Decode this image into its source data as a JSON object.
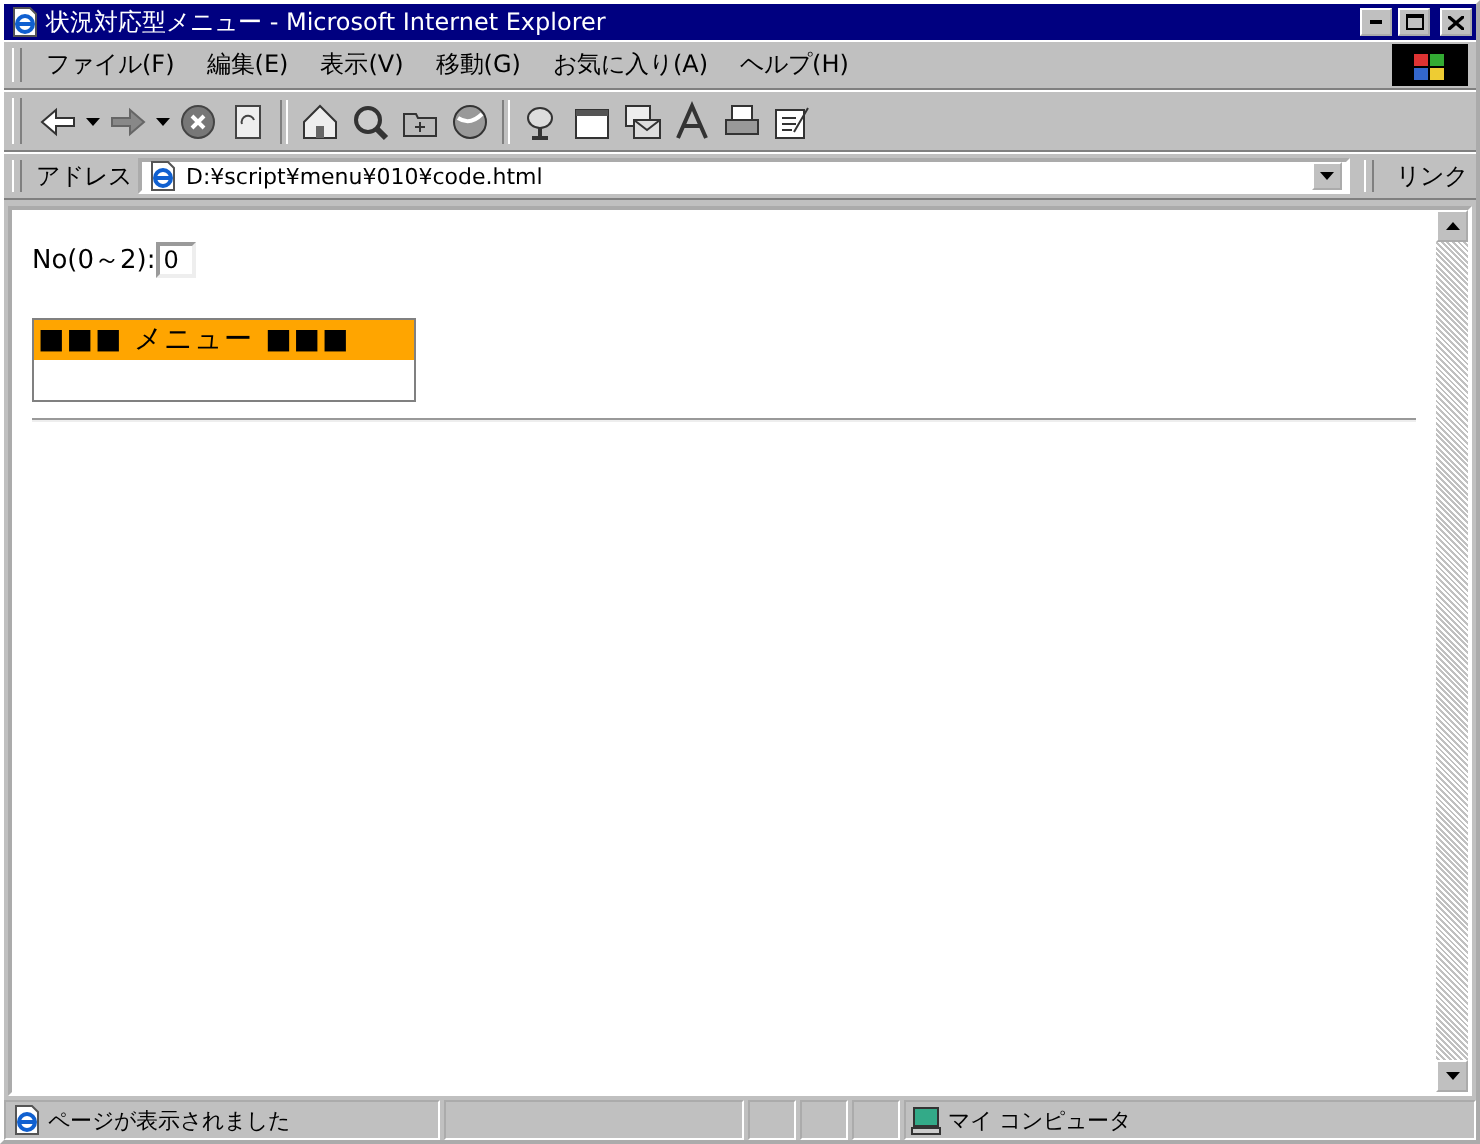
{
  "window": {
    "title": "状況対応型メニュー - Microsoft Internet Explorer"
  },
  "menu_bar": [
    "ファイル(F)",
    "編集(E)",
    "表示(V)",
    "移動(G)",
    "お気に入り(A)",
    "ヘルプ(H)"
  ],
  "address_bar": {
    "label": "アドレス",
    "value": "D:¥script¥menu¥010¥code.html",
    "links": "リンク"
  },
  "page": {
    "field_label": "No(0～2):",
    "field_value": "0",
    "menu_header": "■■■ メニュー ■■■"
  },
  "status_bar": {
    "message": "ページが表示されました",
    "zone": "マイ コンピュータ"
  }
}
